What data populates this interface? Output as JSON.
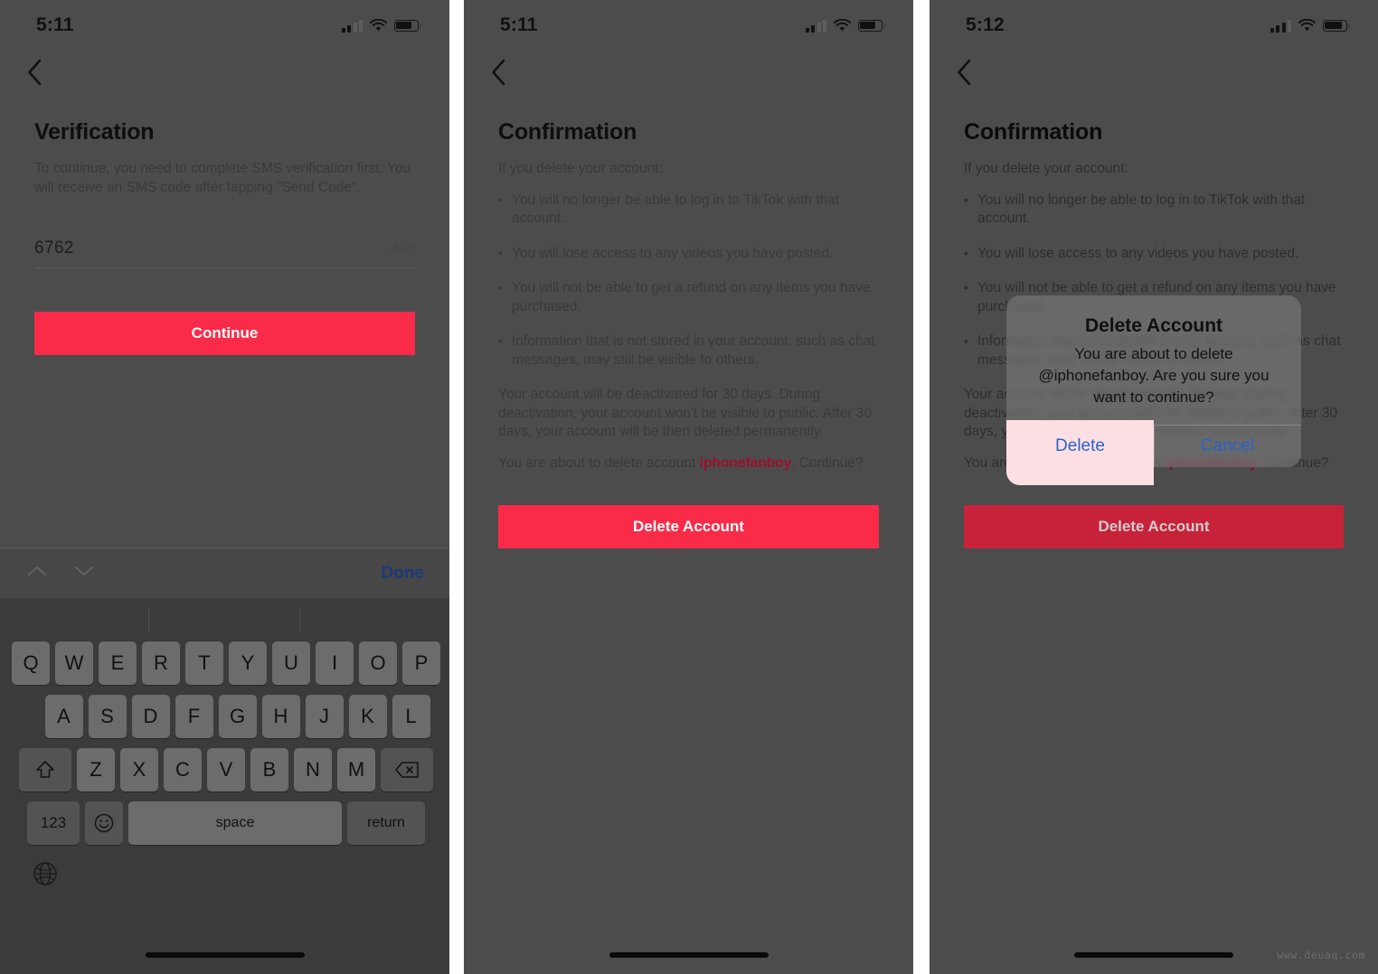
{
  "accent": {
    "tiktok_red": "#fa2b49",
    "link_blue": "#2a63c8",
    "account_red": "#9d1030"
  },
  "watermark": "www.deuaq.com",
  "panels": [
    {
      "id": "verification",
      "status": {
        "time": "5:11",
        "signal_bars_filled": 2,
        "signal_bars_total": 4,
        "wifi": "wifi-icon",
        "battery": "battery-icon"
      },
      "back_icon": "chevron-left-icon",
      "title": "Verification",
      "lead": "To continue, you need to complete SMS verification first. You will receive an SMS code after tapping \"Send Code\".",
      "code_value": "6762",
      "code_timer": "49s",
      "primary_button": "Continue",
      "accessory": {
        "up_icon": "chevron-up-icon",
        "down_icon": "chevron-down-icon",
        "done_label": "Done"
      },
      "keyboard": {
        "row1": [
          "Q",
          "W",
          "E",
          "R",
          "T",
          "Y",
          "U",
          "I",
          "O",
          "P"
        ],
        "row2": [
          "A",
          "S",
          "D",
          "F",
          "G",
          "H",
          "J",
          "K",
          "L"
        ],
        "row3": [
          "Z",
          "X",
          "C",
          "V",
          "B",
          "N",
          "M"
        ],
        "shift_icon": "shift-icon",
        "backspace_icon": "backspace-icon",
        "numeric_label": "123",
        "emoji_icon": "emoji-icon",
        "space_label": "space",
        "return_label": "return",
        "globe_icon": "globe-icon"
      }
    },
    {
      "id": "confirmation",
      "status": {
        "time": "5:11",
        "signal_bars_filled": 2,
        "signal_bars_total": 4,
        "wifi": "wifi-icon",
        "battery": "battery-icon"
      },
      "back_icon": "chevron-left-icon",
      "title": "Confirmation",
      "lead": "If you delete your account:",
      "bullets": [
        "You will no longer be able to log in to TikTok with that account.",
        "You will lose access to any videos you have posted.",
        "You will not be able to get a refund on any items you have purchased.",
        "Information that is not stored in your account, such as chat messages, may still be visible to others."
      ],
      "para": "Your account will be deactivated for 30 days. During deactivation, your account won't be visible to public. After 30 days, your account will be then deleted permanently.",
      "final_prefix": "You are about to delete account ",
      "final_account": "iphonefanboy",
      "final_suffix": ". Continue?",
      "primary_button": "Delete Account"
    },
    {
      "id": "confirmation-dialog",
      "status": {
        "time": "5:12",
        "signal_bars_filled": 3,
        "signal_bars_total": 4,
        "wifi": "wifi-icon",
        "battery": "battery-icon"
      },
      "back_icon": "chevron-left-icon",
      "title": "Confirmation",
      "lead": "If you delete your account:",
      "bullets": [
        "You will no longer be able to log in to TikTok with that account.",
        "You will lose access to any videos you have posted.",
        "You will not be able to get a refund on any items you have purchased.",
        "Information that is not stored in your account, such as chat messages, may still be visible to others."
      ],
      "para": "Your account will be deactivated for 30 days. During deactivation, your account won't be visible to public. After 30 days, your account will be then deleted permanently.",
      "final_prefix": "You are about to delete account ",
      "final_account": "iphonefanboy",
      "final_suffix": ". Continue?",
      "primary_button": "Delete Account",
      "alert": {
        "title": "Delete Account",
        "message": "You are about to delete @iphonefanboy. Are you sure you want to continue?",
        "confirm_label": "Delete",
        "cancel_label": "Cancel",
        "pressed": "Delete"
      }
    }
  ]
}
